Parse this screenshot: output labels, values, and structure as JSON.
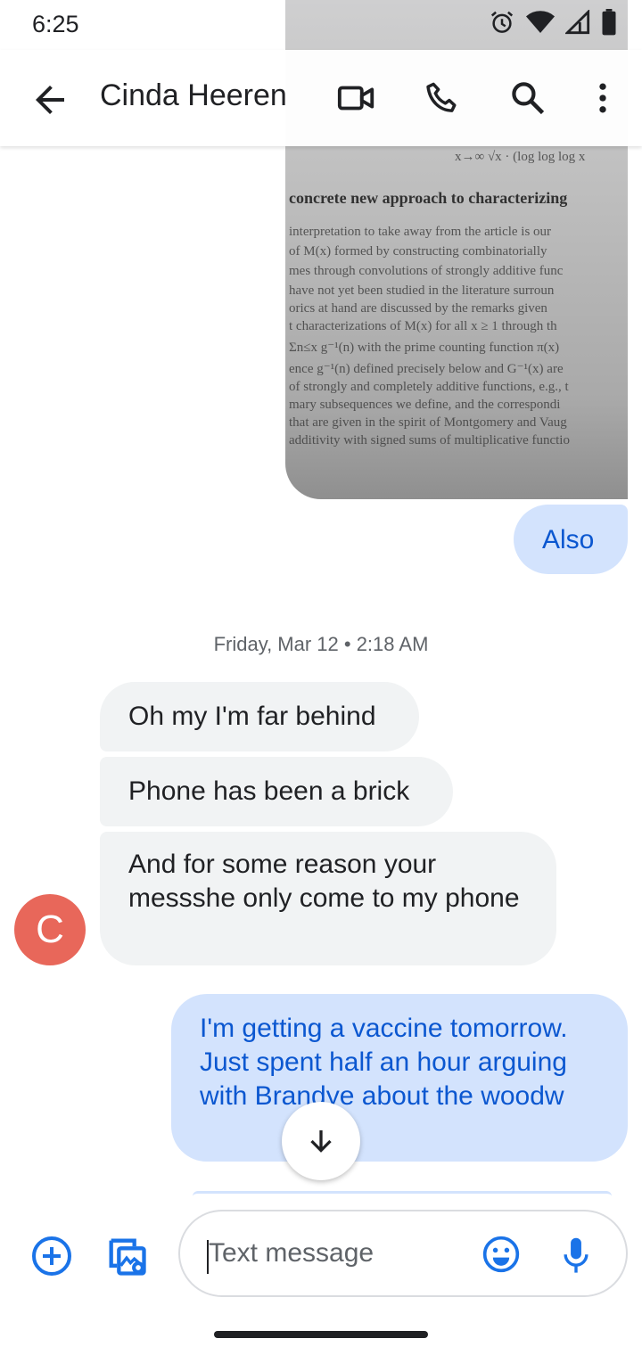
{
  "status_bar": {
    "time": "6:25",
    "icons": [
      "alarm-icon",
      "wifi-icon",
      "signal-icon",
      "battery-icon"
    ]
  },
  "app_bar": {
    "title": "Cinda Heeren",
    "icons": [
      "back-arrow-icon",
      "video-call-icon",
      "phone-icon",
      "search-icon",
      "more-vert-icon"
    ]
  },
  "image_message": {
    "heading": "concrete new approach to characterizing",
    "lines": [
      "interpretation to take away from the article is our",
      "of M(x) formed by constructing combinatorially",
      "mes through convolutions of strongly additive func",
      "have not yet been studied in the literature surroun",
      "orics at hand are discussed by the remarks given",
      "t characterizations of M(x) for all x ≥ 1 through th",
      "Σn≤x g⁻¹(n) with the prime counting function π(x)",
      "ence g⁻¹(n) defined precisely below and G⁻¹(x) are",
      "of strongly and completely additive functions, e.g., t",
      "mary subsequences we define, and the correspondi",
      "that are given in the spirit of Montgomery and Vaug",
      "additivity with signed sums of multiplicative functio"
    ],
    "top_fragment": "x→∞  √x · (log log log x"
  },
  "messages": {
    "outgoing_1": "Also",
    "date_separator": "Friday, Mar 12 • 2:18 AM",
    "incoming_1": "Oh my I'm far behind",
    "incoming_2": "Phone has been a brick",
    "incoming_3": "And for some reason your messshe only come to my phone",
    "avatar_letter": "C",
    "outgoing_2": "I'm getting a vaccine tomorrow. Just spent half an hour arguing with Brandye about the woodw"
  },
  "compose": {
    "placeholder": "Text message",
    "icons": [
      "add-icon",
      "gallery-icon",
      "emoji-icon",
      "mic-icon"
    ]
  },
  "colors": {
    "outgoing_bubble": "#d3e3fd",
    "outgoing_text": "#0b57d0",
    "incoming_bubble": "#f1f3f4",
    "avatar": "#e8675a",
    "accent": "#1a73e8"
  }
}
